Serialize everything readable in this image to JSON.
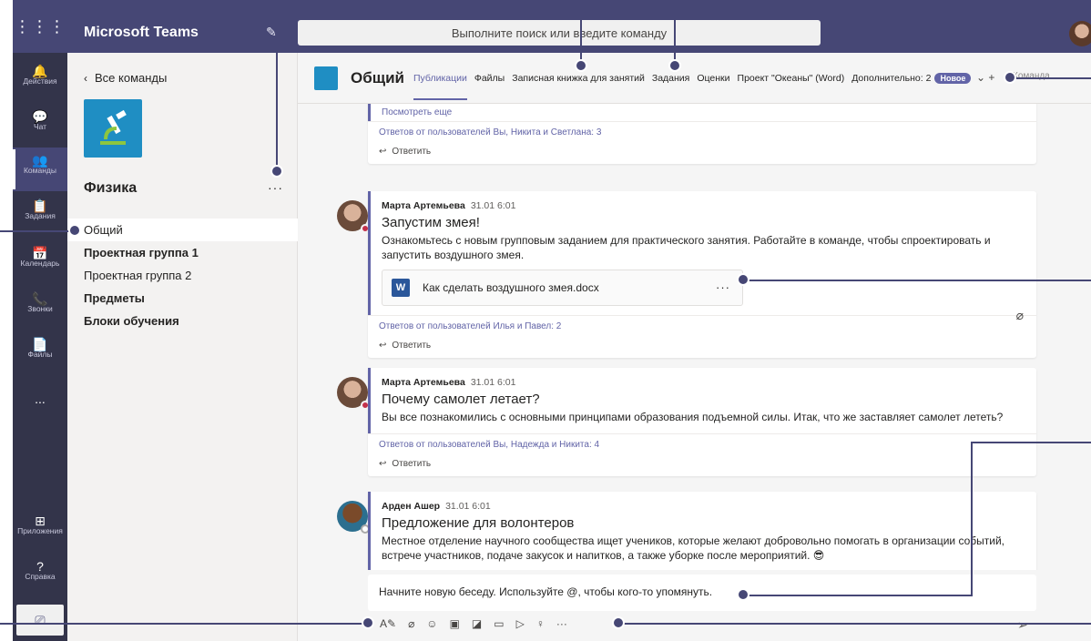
{
  "app": {
    "title": "Microsoft Teams",
    "search_placeholder": "Выполните поиск или введите команду"
  },
  "rail": [
    {
      "label": "Действия",
      "icon": "bell-icon",
      "glyph": "🔔"
    },
    {
      "label": "Чат",
      "icon": "chat-icon",
      "glyph": "💬"
    },
    {
      "label": "Команды",
      "icon": "teams-icon",
      "glyph": "👥"
    },
    {
      "label": "Задания",
      "icon": "assignments-icon",
      "glyph": "📋"
    },
    {
      "label": "Календарь",
      "icon": "calendar-icon",
      "glyph": "📅"
    },
    {
      "label": "Звонки",
      "icon": "phone-icon",
      "glyph": "📞"
    },
    {
      "label": "Файлы",
      "icon": "files-icon",
      "glyph": "📄"
    }
  ],
  "rail_more": "...",
  "rail_bottom": [
    {
      "label": "Приложения",
      "icon": "apps-icon",
      "glyph": "⊞"
    },
    {
      "label": "Справка",
      "icon": "help-icon",
      "glyph": "?"
    }
  ],
  "team": {
    "back_label": "Все команды",
    "name": "Физика",
    "channels": [
      {
        "label": "Общий",
        "selected": true,
        "bold": false
      },
      {
        "label": "Проектная группа 1",
        "selected": false,
        "bold": true
      },
      {
        "label": "Проектная группа 2",
        "selected": false,
        "bold": false
      },
      {
        "label": "Предметы",
        "selected": false,
        "bold": true
      },
      {
        "label": "Блоки обучения",
        "selected": false,
        "bold": true
      }
    ]
  },
  "channel": {
    "title": "Общий",
    "tabs": [
      "Публикации",
      "Файлы",
      "Записная книжка для занятий",
      "Задания",
      "Оценки",
      "Проект \"Океаны\" (Word)",
      "Дополнительно: 2"
    ],
    "active_tab": "Публикации",
    "new_badge": "Новое",
    "team_chip": "Команда"
  },
  "feed": {
    "top_see_more": "Посмотреть еще",
    "top_replies": "Ответов от пользователей Вы, Никита и Светлана: 3",
    "reply_label": "Ответить",
    "posts": [
      {
        "author": "Марта Артемьева",
        "time": "31.01 6:01",
        "subject": "Запустим змея!",
        "text": "Ознакомьтесь с новым групповым заданием для практического занятия. Работайте в команде, чтобы спроектировать и запустить воздушного змея.",
        "attachment": "Как сделать воздушного змея.docx",
        "replies": "Ответов от пользователей Илья и Павел: 2"
      },
      {
        "author": "Марта Артемьева",
        "time": "31.01 6:01",
        "subject": "Почему самолет летает?",
        "text": "Вы все познакомились с основными принципами образования подъемной силы. Итак, что же заставляет самолет лететь?",
        "replies": "Ответов от пользователей Вы, Надежда и Никита: 4"
      },
      {
        "author": "Арден Ашер",
        "time": "31.01 6:01",
        "subject": "Предложение для волонтеров",
        "text": "Местное отделение научного сообщества ищет учеников, которые желают добровольно помогать в организации событий, встрече участников, подаче закусок и напитков, а также уборке после мероприятий. 😎"
      }
    ]
  },
  "compose": {
    "placeholder": "Начните новую беседу. Используйте @, чтобы кого-то упомянуть."
  },
  "colors": {
    "brand": "#464775",
    "accent": "#6264a7",
    "rail": "#33344a",
    "presence_busy": "#c4314b"
  }
}
